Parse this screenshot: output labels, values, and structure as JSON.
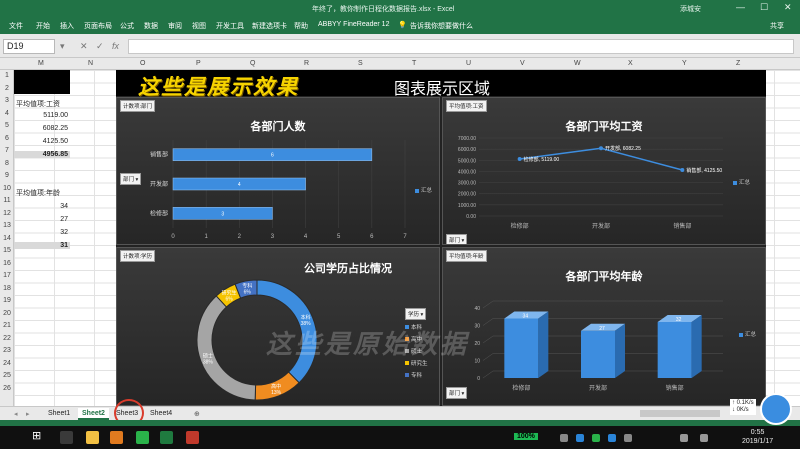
{
  "titlebar": {
    "doc_title": "年终了，教你制作日程化数据报告.xlsx - Excel",
    "user": "添城安",
    "min": "—",
    "max": "☐",
    "close": "✕"
  },
  "ribbon": {
    "tabs": [
      "文件",
      "开始",
      "插入",
      "页面布局",
      "公式",
      "数据",
      "审阅",
      "视图",
      "开发工具",
      "新建选项卡",
      "帮助",
      "ABBYY FineReader 12"
    ],
    "search": "告诉我你想要做什么",
    "share": "共享"
  },
  "formula_bar": {
    "name_box": "D19",
    "cancel": "✕",
    "enter": "✓",
    "fx": "fx",
    "value": ""
  },
  "columns": [
    "M",
    "N",
    "O",
    "P",
    "Q",
    "R",
    "S",
    "T",
    "U",
    "V",
    "W",
    "X",
    "Y",
    "Z"
  ],
  "rows": [
    "1",
    "2",
    "3",
    "4",
    "5",
    "6",
    "7",
    "8",
    "9",
    "10",
    "11",
    "12",
    "13",
    "14",
    "15",
    "16",
    "17",
    "18",
    "19",
    "20",
    "21",
    "22",
    "23",
    "24",
    "25",
    "26"
  ],
  "cells": {
    "salary_label": "平均值项:工资",
    "salary_values": [
      "5119.00",
      "6082.25",
      "4125.50"
    ],
    "salary_total": "4956.85",
    "age_label": "平均值项:年龄",
    "age_values": [
      "34",
      "27",
      "32"
    ],
    "age_total": "31"
  },
  "dashboard": {
    "title": "这些是展示效果",
    "subtitle": "图表展示区域",
    "watermark": "这些是原始数据"
  },
  "panels": {
    "headcount": {
      "tag": "计数项:部门",
      "title": "各部门人数",
      "filter": "部门 ▾",
      "legend": "汇总"
    },
    "salary": {
      "tag": "平均值项:工资",
      "title": "各部门平均工资",
      "filter": "部门 ▾",
      "legend": "汇总"
    },
    "education": {
      "tag": "计数项:学历",
      "title": "公司学历占比情况",
      "legend_header": "学历 ▾"
    },
    "age": {
      "tag": "平均值项:年龄",
      "title": "各部门平均年龄",
      "filter": "部门 ▾",
      "legend": "汇总"
    }
  },
  "chart_data": [
    {
      "type": "bar",
      "title": "各部门人数",
      "categories": [
        "检修部",
        "开发部",
        "销售部"
      ],
      "series": [
        {
          "name": "汇总",
          "values": [
            3,
            4,
            6
          ]
        }
      ],
      "xlim": [
        0,
        7
      ],
      "xticks": [
        "0",
        "1",
        "2",
        "3",
        "4",
        "5",
        "6",
        "7"
      ],
      "data_labels": [
        "3",
        "4",
        "6"
      ],
      "color": "#3d8ddf",
      "legend": "right"
    },
    {
      "type": "line",
      "title": "各部门平均工资",
      "categories": [
        "检修部",
        "开发部",
        "销售部"
      ],
      "series": [
        {
          "name": "汇总",
          "values": [
            5119.0,
            6082.25,
            4125.5
          ]
        }
      ],
      "ylim": [
        0,
        7000
      ],
      "yticks": [
        "0.00",
        "1000.00",
        "2000.00",
        "3000.00",
        "4000.00",
        "5000.00",
        "6000.00",
        "7000.00"
      ],
      "data_labels": [
        "检修部, 5119.00",
        "开发部, 6082.25",
        "销售部, 4125.50"
      ],
      "color": "#3d8ddf",
      "legend": "right"
    },
    {
      "type": "pie",
      "title": "公司学历占比情况",
      "slices": [
        {
          "label": "本科",
          "percent": 38
        },
        {
          "label": "高中",
          "percent": 13
        },
        {
          "label": "硕士",
          "percent": 38
        },
        {
          "label": "研究生",
          "percent": 6
        },
        {
          "label": "专科",
          "percent": 6
        }
      ],
      "colors": [
        "#3d8ddf",
        "#f08c20",
        "#a5a5a5",
        "#f6c400",
        "#4472c4"
      ],
      "legend": "right"
    },
    {
      "type": "bar",
      "title": "各部门平均年龄",
      "categories": [
        "检修部",
        "开发部",
        "销售部"
      ],
      "series": [
        {
          "name": "汇总",
          "values": [
            34,
            27,
            32
          ]
        }
      ],
      "ylim": [
        0,
        40
      ],
      "yticks": [
        "0",
        "10",
        "20",
        "30",
        "40"
      ],
      "data_labels": [
        "34",
        "27",
        "32"
      ],
      "color": "#3d8ddf",
      "legend": "right"
    }
  ],
  "sheet_tabs": [
    "Sheet1",
    "Sheet2",
    "Sheet3",
    "Sheet4"
  ],
  "active_sheet": "Sheet2",
  "taskbar": {
    "battery": "100%",
    "time": "0:55",
    "date": "2019/1/17"
  },
  "zoom_widget": {
    "line1": "↑ 0.1K/s",
    "line2": "↓ 0K/s"
  }
}
